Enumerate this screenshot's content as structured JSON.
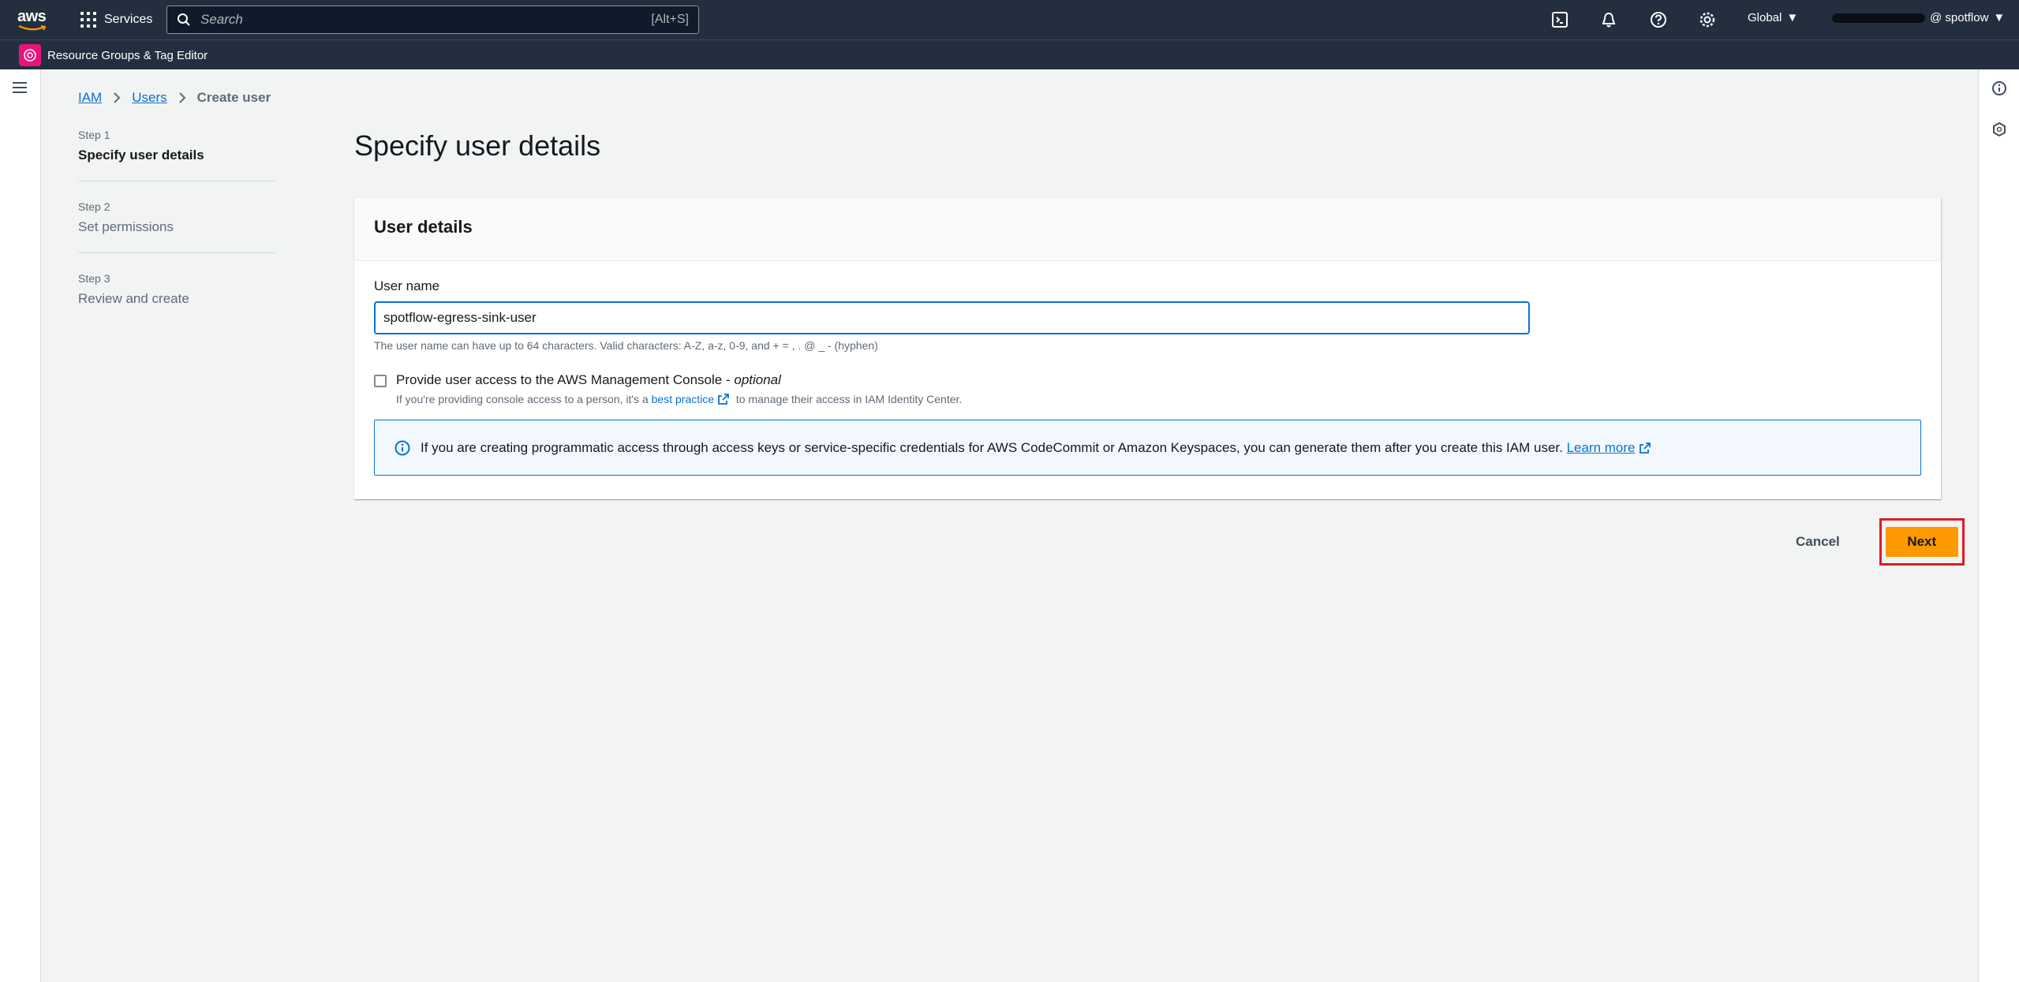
{
  "topnav": {
    "logo_text": "aws",
    "services_label": "Services",
    "search_placeholder": "Search",
    "search_shortcut": "[Alt+S]",
    "region_label": "Global",
    "account_suffix": "@ spotflow"
  },
  "subnav": {
    "resource_groups_label": "Resource Groups & Tag Editor"
  },
  "breadcrumb": {
    "items": [
      {
        "label": "IAM"
      },
      {
        "label": "Users"
      },
      {
        "label": "Create user"
      }
    ]
  },
  "steps": [
    {
      "num": "Step 1",
      "title": "Specify user details",
      "active": true
    },
    {
      "num": "Step 2",
      "title": "Set permissions",
      "active": false
    },
    {
      "num": "Step 3",
      "title": "Review and create",
      "active": false
    }
  ],
  "main": {
    "page_title": "Specify user details",
    "panel_title": "User details",
    "user_name_label": "User name",
    "user_name_value": "spotflow-egress-sink-user",
    "user_name_hint": "The user name can have up to 64 characters. Valid characters: A-Z, a-z, 0-9, and + = , . @ _ - (hyphen)",
    "console_access_label": "Provide user access to the AWS Management Console - ",
    "console_access_optional": "optional",
    "console_access_desc_before": "If you're providing console access to a person, it's a ",
    "console_access_desc_link": "best practice",
    "console_access_desc_after": " to manage their access in IAM Identity Center.",
    "info_text": "If you are creating programmatic access through access keys or service-specific credentials for AWS CodeCommit or Amazon Keyspaces, you can generate them after you create this IAM user. ",
    "info_link": "Learn more"
  },
  "actions": {
    "cancel_label": "Cancel",
    "next_label": "Next"
  },
  "colors": {
    "nav_bg": "#232f3e",
    "link": "#0972d3",
    "primary_button": "#ff9900",
    "highlight": "#e01b24"
  }
}
